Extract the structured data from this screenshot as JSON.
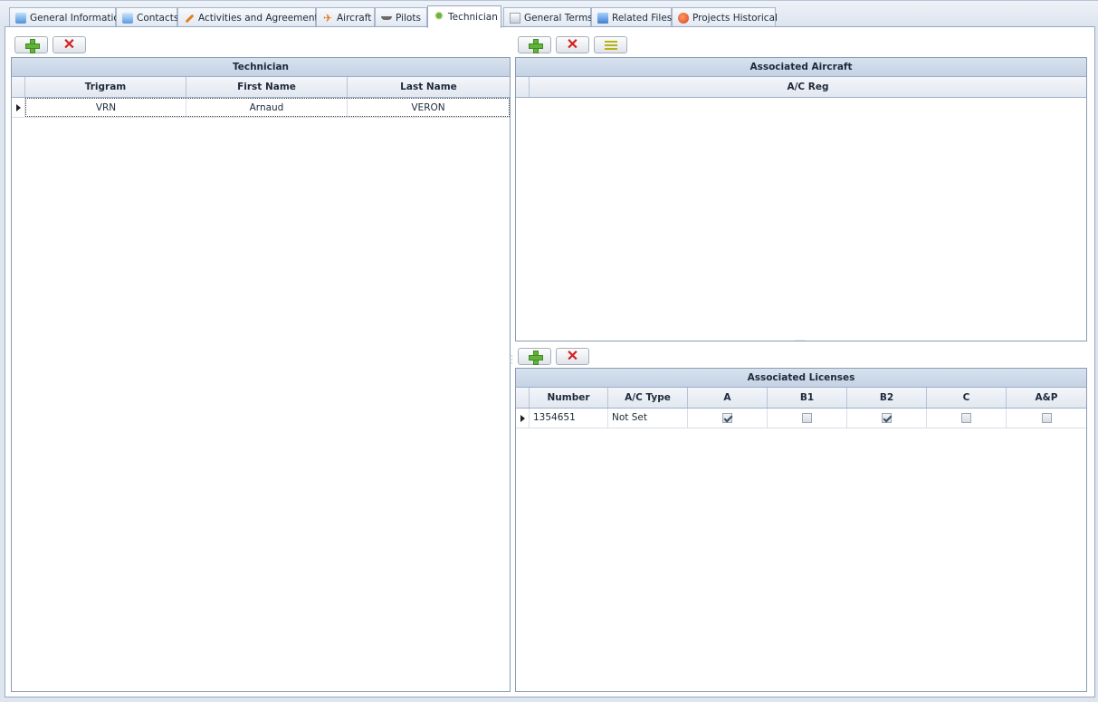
{
  "tabs": [
    {
      "label": "General Information",
      "icon": "info-icon",
      "active": false
    },
    {
      "label": "Contacts",
      "icon": "contacts-icon",
      "active": false
    },
    {
      "label": "Activities and Agreements",
      "icon": "wrench-icon",
      "active": false
    },
    {
      "label": "Aircraft",
      "icon": "aircraft-icon",
      "active": false
    },
    {
      "label": "Pilots",
      "icon": "pilot-wings-icon",
      "active": false
    },
    {
      "label": "Technician",
      "icon": "gear-icon",
      "active": true
    },
    {
      "label": "General Terms",
      "icon": "document-icon",
      "active": false
    },
    {
      "label": "Related Files",
      "icon": "files-icon",
      "active": false
    },
    {
      "label": "Projects Historical",
      "icon": "history-icon",
      "active": false
    }
  ],
  "technician_grid": {
    "caption": "Technician",
    "columns": [
      "Trigram",
      "First Name",
      "Last Name"
    ],
    "rows": [
      {
        "trigram": "VRN",
        "first_name": "Arnaud",
        "last_name": "VERON"
      }
    ]
  },
  "aircraft_grid": {
    "caption": "Associated Aircraft",
    "columns": [
      "A/C Reg"
    ],
    "rows": []
  },
  "licenses_grid": {
    "caption": "Associated Licenses",
    "columns": [
      "Number",
      "A/C Type",
      "A",
      "B1",
      "B2",
      "C",
      "A&P"
    ],
    "rows": [
      {
        "number": "1354651",
        "ac_type": "Not Set",
        "A": true,
        "B1": false,
        "B2": true,
        "C": false,
        "AP": false
      }
    ]
  },
  "colors": {
    "grid_caption": "#c4d2e4",
    "add_green": "#63b33a",
    "delete_red": "#d32020"
  }
}
